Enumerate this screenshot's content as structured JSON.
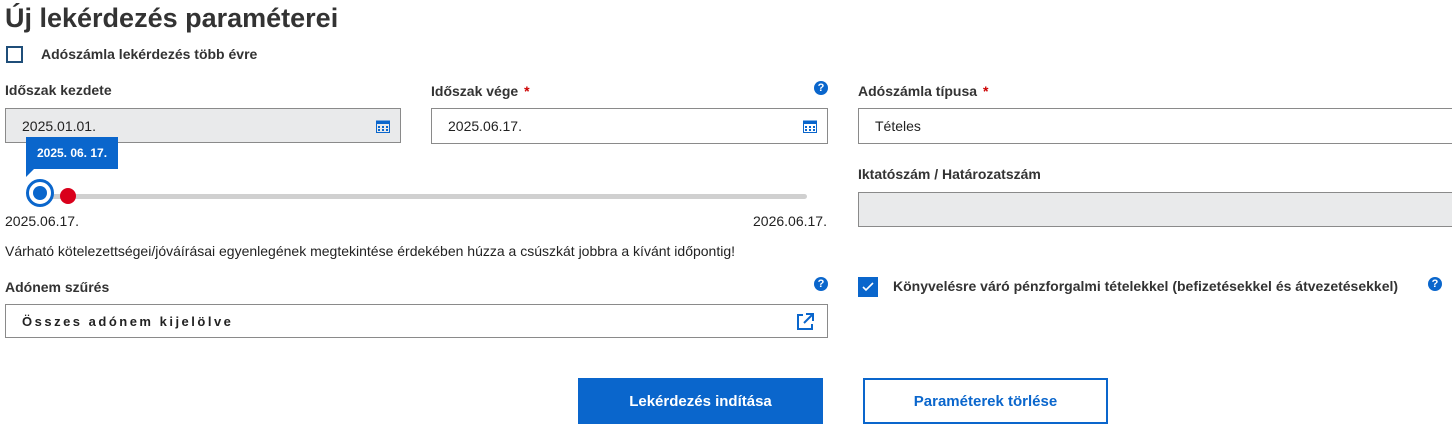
{
  "title": "Új lekérdezés paraméterei",
  "multi_year": {
    "label": "Adószámla lekérdezés több évre",
    "checked": false
  },
  "period_start": {
    "label": "Időszak kezdete",
    "value": "2025.01.01."
  },
  "period_end": {
    "label": "Időszak vége",
    "required_mark": "*",
    "value": "2025.06.17."
  },
  "account_type": {
    "label": "Adószámla típusa",
    "required_mark": "*",
    "value": "Tételes"
  },
  "filing_number": {
    "label": "Iktatószám / Határozatszám",
    "value": ""
  },
  "slider": {
    "tooltip": "2025. 06. 17.",
    "min_label": "2025.06.17.",
    "max_label": "2026.06.17.",
    "position": 0.0
  },
  "hint": "Várható kötelezettségei/jóváírásai egyenlegének megtekintése érdekében húzza a csúszkát jobbra a kívánt időpontig!",
  "tax_filter": {
    "label": "Adónem szűrés",
    "value": "Összes adónem kijelölve"
  },
  "pending_items": {
    "label": "Könyvelésre váró pénzforgalmi tételekkel (befizetésekkel és átvezetésekkel)",
    "checked": true
  },
  "help_glyph": "?",
  "buttons": {
    "start": "Lekérdezés indítása",
    "clear": "Paraméterek törlése"
  },
  "colors": {
    "accent": "#0a66cc",
    "required": "#cc0000",
    "slider_marker": "#d9001b",
    "disabled_bg": "#e9eaeb"
  }
}
